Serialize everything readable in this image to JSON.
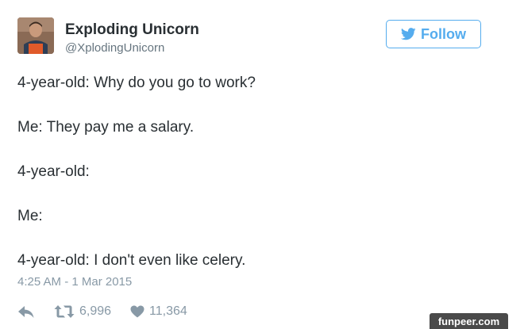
{
  "author": {
    "display_name": "Exploding Unicorn",
    "handle": "@XplodingUnicorn"
  },
  "follow_button": {
    "label": "Follow",
    "icon": "twitter-bird-icon"
  },
  "tweet": {
    "lines": [
      "4-year-old: Why do you go to work?",
      "Me: They pay me a salary.",
      "4-year-old:",
      "Me:",
      "4-year-old: I don't even like celery."
    ],
    "timestamp": "4:25 AM - 1 Mar 2015"
  },
  "actions": {
    "reply_icon": "reply-icon",
    "retweet_icon": "retweet-icon",
    "retweet_count": "6,996",
    "like_icon": "heart-icon",
    "like_count": "11,364"
  },
  "watermark": "funpeer.com",
  "colors": {
    "accent": "#55acee",
    "text": "#292f33",
    "muted": "#8899a6"
  }
}
